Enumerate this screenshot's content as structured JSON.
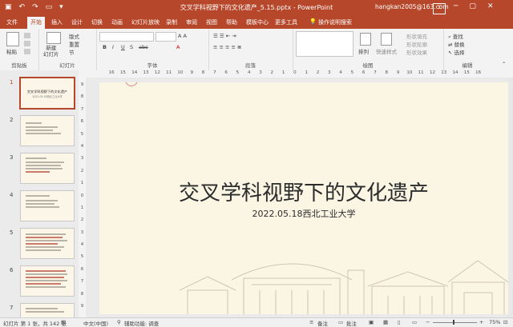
{
  "window": {
    "title": "交叉学科视野下的文化遗产_5.15.pptx - PowerPoint",
    "account": "hangkan2005@163.com"
  },
  "tabs": [
    "文件",
    "开始",
    "插入",
    "设计",
    "切换",
    "动画",
    "幻灯片放映",
    "录制",
    "审阅",
    "视图",
    "帮助",
    "模板中心",
    "更多工具"
  ],
  "tell_me": "操作说明搜索",
  "ribbon": {
    "clipboard": {
      "paste": "粘贴",
      "label": "剪贴板"
    },
    "slides": {
      "new_slide": "新建\n幻灯片",
      "layout": "版式",
      "reset": "重置",
      "section": "节",
      "label": "幻灯片"
    },
    "font": {
      "label": "字体"
    },
    "paragraph": {
      "label": "段落"
    },
    "drawing": {
      "arrange": "排列",
      "quick_styles": "快速样式",
      "fill": "形状填充",
      "outline": "形状轮廓",
      "effects": "形状效果",
      "label": "绘图"
    },
    "editing": {
      "find": "查找",
      "replace": "替换",
      "select": "选择",
      "label": "编辑"
    }
  },
  "ruler_top": [
    "16",
    "15",
    "14",
    "13",
    "12",
    "11",
    "10",
    "9",
    "8",
    "7",
    "6",
    "5",
    "4",
    "3",
    "2",
    "1",
    "0",
    "1",
    "2",
    "3",
    "4",
    "5",
    "6",
    "7",
    "8",
    "9",
    "10",
    "11",
    "12",
    "13",
    "14",
    "15",
    "16"
  ],
  "ruler_left": [
    "9",
    "8",
    "7",
    "6",
    "5",
    "4",
    "3",
    "2",
    "1",
    "0",
    "1",
    "2",
    "3",
    "4",
    "5",
    "6",
    "7",
    "8",
    "9"
  ],
  "thumbnails": [
    {
      "num": "1",
      "title": "交叉学科视野下的文化遗产",
      "sub": "2022.05.18西北工业大学"
    },
    {
      "num": "2"
    },
    {
      "num": "3"
    },
    {
      "num": "4"
    },
    {
      "num": "5"
    },
    {
      "num": "6"
    },
    {
      "num": "7"
    }
  ],
  "slide": {
    "title": "交叉学科视野下的文化遗产",
    "subtitle": "2022.05.18西北工业大学"
  },
  "status": {
    "slide_count": "幻灯片 第 1 张，共 142 张",
    "language": "中文(中国)",
    "accessibility": "辅助功能: 调查",
    "notes": "备注",
    "comments": "批注",
    "zoom": "75%"
  },
  "colors": {
    "accent": "#b7472a",
    "slide_bg": "#fbf6e4"
  }
}
